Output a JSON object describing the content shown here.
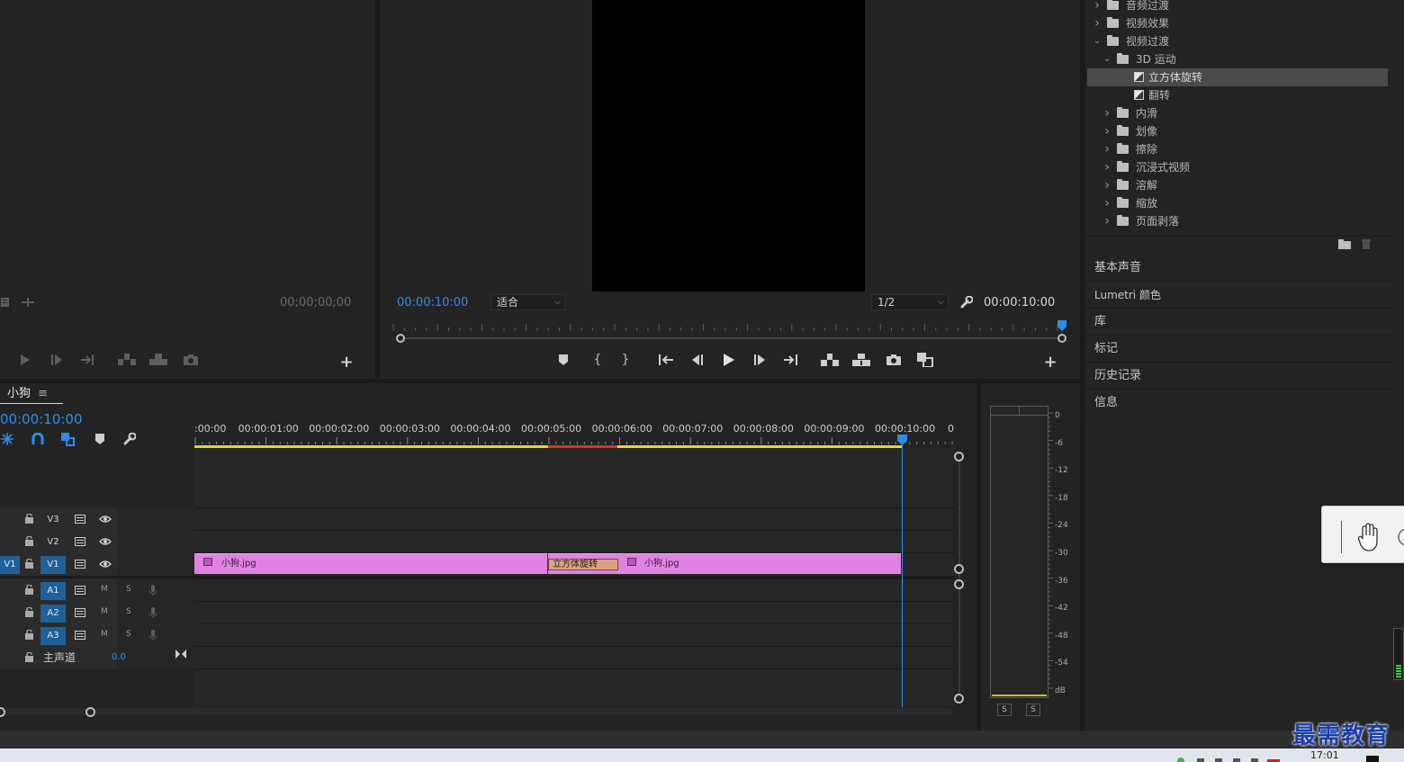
{
  "source_monitor": {
    "timecode": "00;00;00;00"
  },
  "program_monitor": {
    "timecode_current": "00:00:10:00",
    "fit_dropdown": "适合",
    "resolution_dropdown": "1/2",
    "timecode_duration": "00:00:10:00"
  },
  "effects_tree": [
    {
      "label": "音频过渡",
      "level": 0,
      "expanded": false,
      "type": "folder"
    },
    {
      "label": "视频效果",
      "level": 0,
      "expanded": false,
      "type": "folder"
    },
    {
      "label": "视频过渡",
      "level": 0,
      "expanded": true,
      "type": "folder"
    },
    {
      "label": "3D 运动",
      "level": 1,
      "expanded": true,
      "type": "folder"
    },
    {
      "label": "立方体旋转",
      "level": 2,
      "type": "effect",
      "selected": true
    },
    {
      "label": "翻转",
      "level": 2,
      "type": "effect"
    },
    {
      "label": "内滑",
      "level": 1,
      "expanded": false,
      "type": "folder"
    },
    {
      "label": "划像",
      "level": 1,
      "expanded": false,
      "type": "folder"
    },
    {
      "label": "擦除",
      "level": 1,
      "expanded": false,
      "type": "folder"
    },
    {
      "label": "沉浸式视频",
      "level": 1,
      "expanded": false,
      "type": "folder"
    },
    {
      "label": "溶解",
      "level": 1,
      "expanded": false,
      "type": "folder"
    },
    {
      "label": "缩放",
      "level": 1,
      "expanded": false,
      "type": "folder"
    },
    {
      "label": "页面剥落",
      "level": 1,
      "expanded": false,
      "type": "folder"
    }
  ],
  "right_panels": [
    "基本声音",
    "Lumetri 颜色",
    "库",
    "标记",
    "历史记录",
    "信息"
  ],
  "timeline": {
    "sequence_name": "小狗",
    "menu_icon": "≡",
    "timecode": "00:00:10:00",
    "ruler_labels": [
      ":00:00",
      "00:00:01:00",
      "00:00:02:00",
      "00:00:03:00",
      "00:00:04:00",
      "00:00:05:00",
      "00:00:06:00",
      "00:00:07:00",
      "00:00:08:00",
      "00:00:09:00",
      "00:00:10:00",
      "0"
    ],
    "video_tracks": [
      {
        "name": "V3",
        "source": ""
      },
      {
        "name": "V2",
        "source": ""
      },
      {
        "name": "V1",
        "source": "V1"
      }
    ],
    "audio_tracks": [
      {
        "name": "A1",
        "m": "M",
        "s": "S"
      },
      {
        "name": "A2",
        "m": "M",
        "s": "S"
      },
      {
        "name": "A3",
        "m": "M",
        "s": "S"
      }
    ],
    "master": {
      "label": "主声道",
      "value": "0.0"
    },
    "clips": [
      {
        "name": "小狗.jpg",
        "color": "#e082e0"
      },
      {
        "name": "小狗.jpg",
        "color": "#e082e0"
      }
    ],
    "transition": {
      "name": "立方体旋转"
    }
  },
  "audio_meter": {
    "labels": [
      "0",
      "-6",
      "-12",
      "-18",
      "-24",
      "-30",
      "-36",
      "-42",
      "-48",
      "-54",
      "dB"
    ],
    "solo_left": "S",
    "solo_right": "S"
  },
  "watermark": "最需教育",
  "taskbar": {
    "time": "17:01"
  },
  "colors": {
    "accent_blue": "#2d8ceb",
    "clip_pink": "#e082e0",
    "transition_tan": "#d6a383",
    "work_area_yellow": "#e6d52a",
    "render_red": "#d8342a"
  }
}
